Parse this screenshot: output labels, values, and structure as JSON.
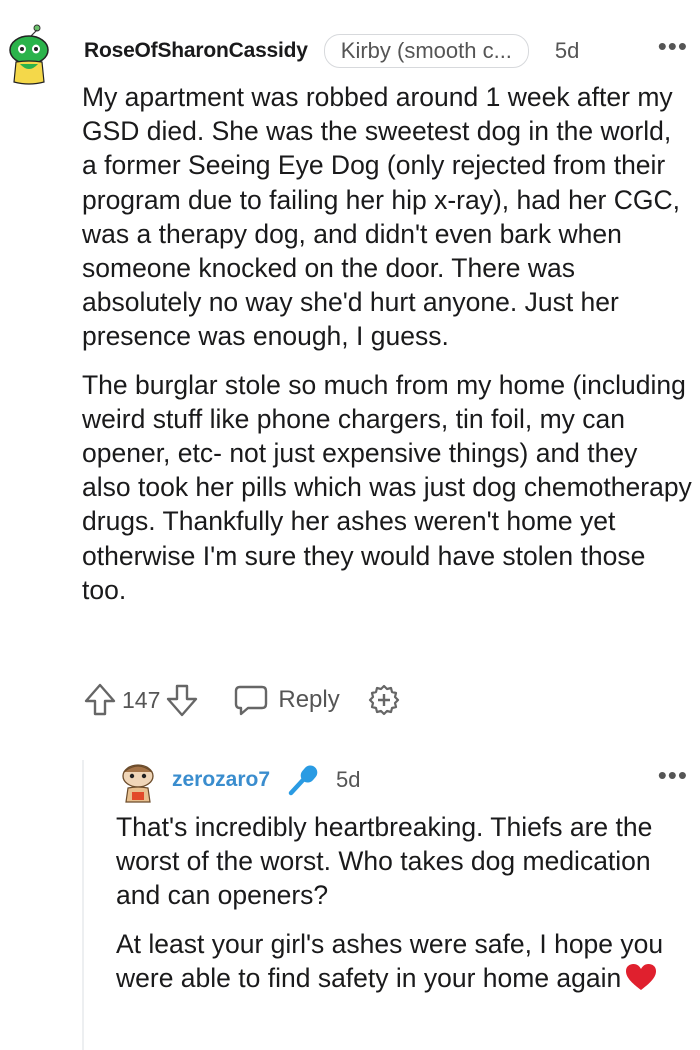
{
  "comment": {
    "username": "RoseOfSharonCassidy",
    "flair": "Kirby (smooth c...",
    "time": "5d",
    "more_icon": "ellipsis-horizontal-icon",
    "avatar_icon": "green-snoo-avatar",
    "paragraphs": [
      "My apartment was robbed around 1 week after my GSD died. She was the sweetest dog in the world, a former Seeing Eye Dog (only rejected from their program due to failing her hip x-ray), had her CGC, was a therapy dog, and didn't even bark when someone knocked on the door. There was absolutely no way she'd hurt anyone. Just her presence was enough, I guess.",
      "The burglar stole so much from my home (including weird stuff like phone chargers, tin foil, my can opener, etc- not just expensive things) and they also took her pills which was just dog chemotherapy drugs. Thankfully her ashes weren't home yet otherwise I'm sure they would have stolen those too."
    ],
    "votes": "147",
    "reply_label": "Reply"
  },
  "reply": {
    "username": "zerozaro7",
    "time": "5d",
    "avatar_icon": "orange-snoo-avatar",
    "badge_icon": "microphone-icon",
    "paragraphs": [
      "That's incredibly heartbreaking. Thiefs are the worst of the worst. Who takes dog medication and can openers?",
      "At least your girl's ashes were safe, I hope you were able to find safety in your home again"
    ],
    "emoji_icon": "red-heart-emoji"
  },
  "colors": {
    "text": "#1a1a1b",
    "muted": "#555555",
    "reply_username": "#3a8dce",
    "thread_line": "#edeff1",
    "heart": "#e0202e"
  }
}
